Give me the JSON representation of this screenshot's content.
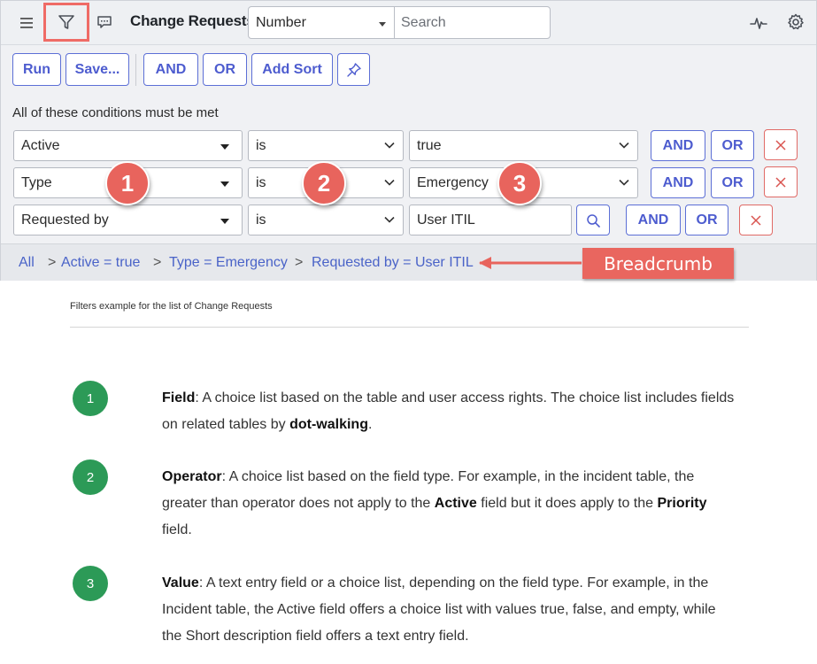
{
  "header": {
    "title": "Change Requests",
    "search_field_select": "Number",
    "search_placeholder": "Search"
  },
  "toolbar": {
    "run": "Run",
    "save": "Save...",
    "and": "AND",
    "or": "OR",
    "add_sort": "Add Sort"
  },
  "conditions": {
    "heading": "All of these conditions must be met",
    "rows": [
      {
        "field": "Active",
        "operator": "is",
        "value": "true",
        "and": "AND",
        "or": "OR"
      },
      {
        "field": "Type",
        "operator": "is",
        "value": "Emergency",
        "and": "AND",
        "or": "OR"
      },
      {
        "field": "Requested by",
        "operator": "is",
        "value": "User ITIL",
        "and": "AND",
        "or": "OR"
      }
    ]
  },
  "badges": [
    "1",
    "2",
    "3"
  ],
  "breadcrumb": {
    "items": [
      "All",
      "Active = true",
      "Type = Emergency",
      "Requested by = User ITIL"
    ],
    "separator": ">",
    "callout": "Breadcrumb"
  },
  "colors": {
    "accent": "#4d5ccf",
    "annotation": "#e8645d",
    "step": "#2c9a57"
  },
  "doc": {
    "caption": "Filters example for the list of Change Requests",
    "steps": [
      {
        "number": "1",
        "term": "Field",
        "text_a": ": A choice list based on the table and user access rights. The choice list includes fields on related tables by ",
        "bold_a": "dot-walking",
        "text_b": "."
      },
      {
        "number": "2",
        "term": "Operator",
        "text_a": ": A choice list based on the field type. For example, in the incident table, the greater than operator does not apply to the ",
        "bold_a": "Active",
        "text_b": " field but it does apply to the ",
        "bold_b": "Priority",
        "text_c": " field."
      },
      {
        "number": "3",
        "term": "Value",
        "text_a": ": A text entry field or a choice list, depending on the field type. For example, in the Incident table, the Active field offers a choice list with values true, false, and empty, while the Short description field offers a text entry field."
      }
    ]
  }
}
